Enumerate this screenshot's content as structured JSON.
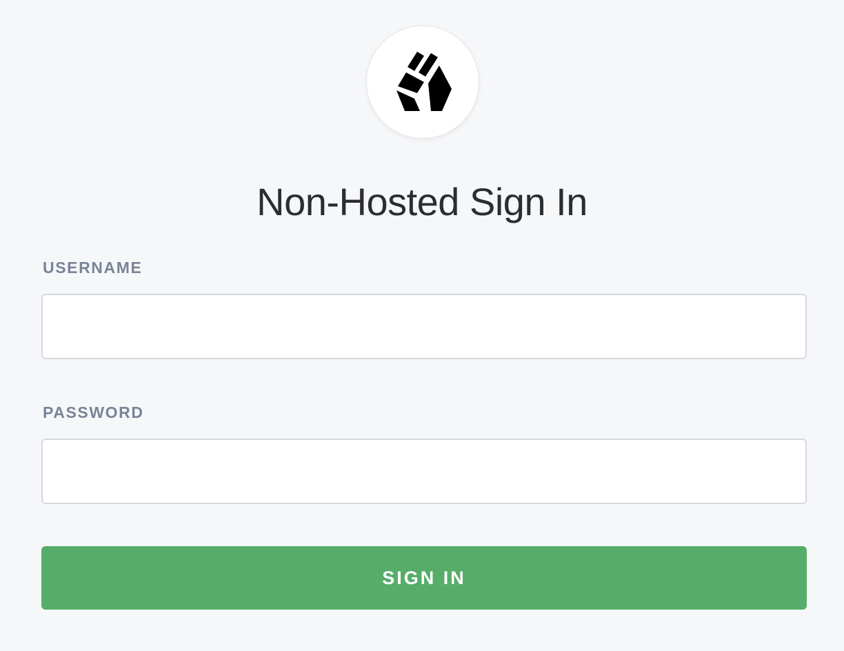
{
  "logo": {
    "icon": "brand-cube-logo-icon"
  },
  "page": {
    "title": "Non-Hosted Sign In"
  },
  "form": {
    "username": {
      "label": "USERNAME",
      "value": "",
      "placeholder": ""
    },
    "password": {
      "label": "PASSWORD",
      "value": "",
      "placeholder": ""
    },
    "submit_label": "SIGN IN"
  },
  "colors": {
    "background": "#f6f7f9",
    "title": "#2b2d31",
    "label": "#7a8397",
    "input_border": "#d5d8df",
    "button": "#56ad69",
    "button_text": "#ffffff"
  }
}
